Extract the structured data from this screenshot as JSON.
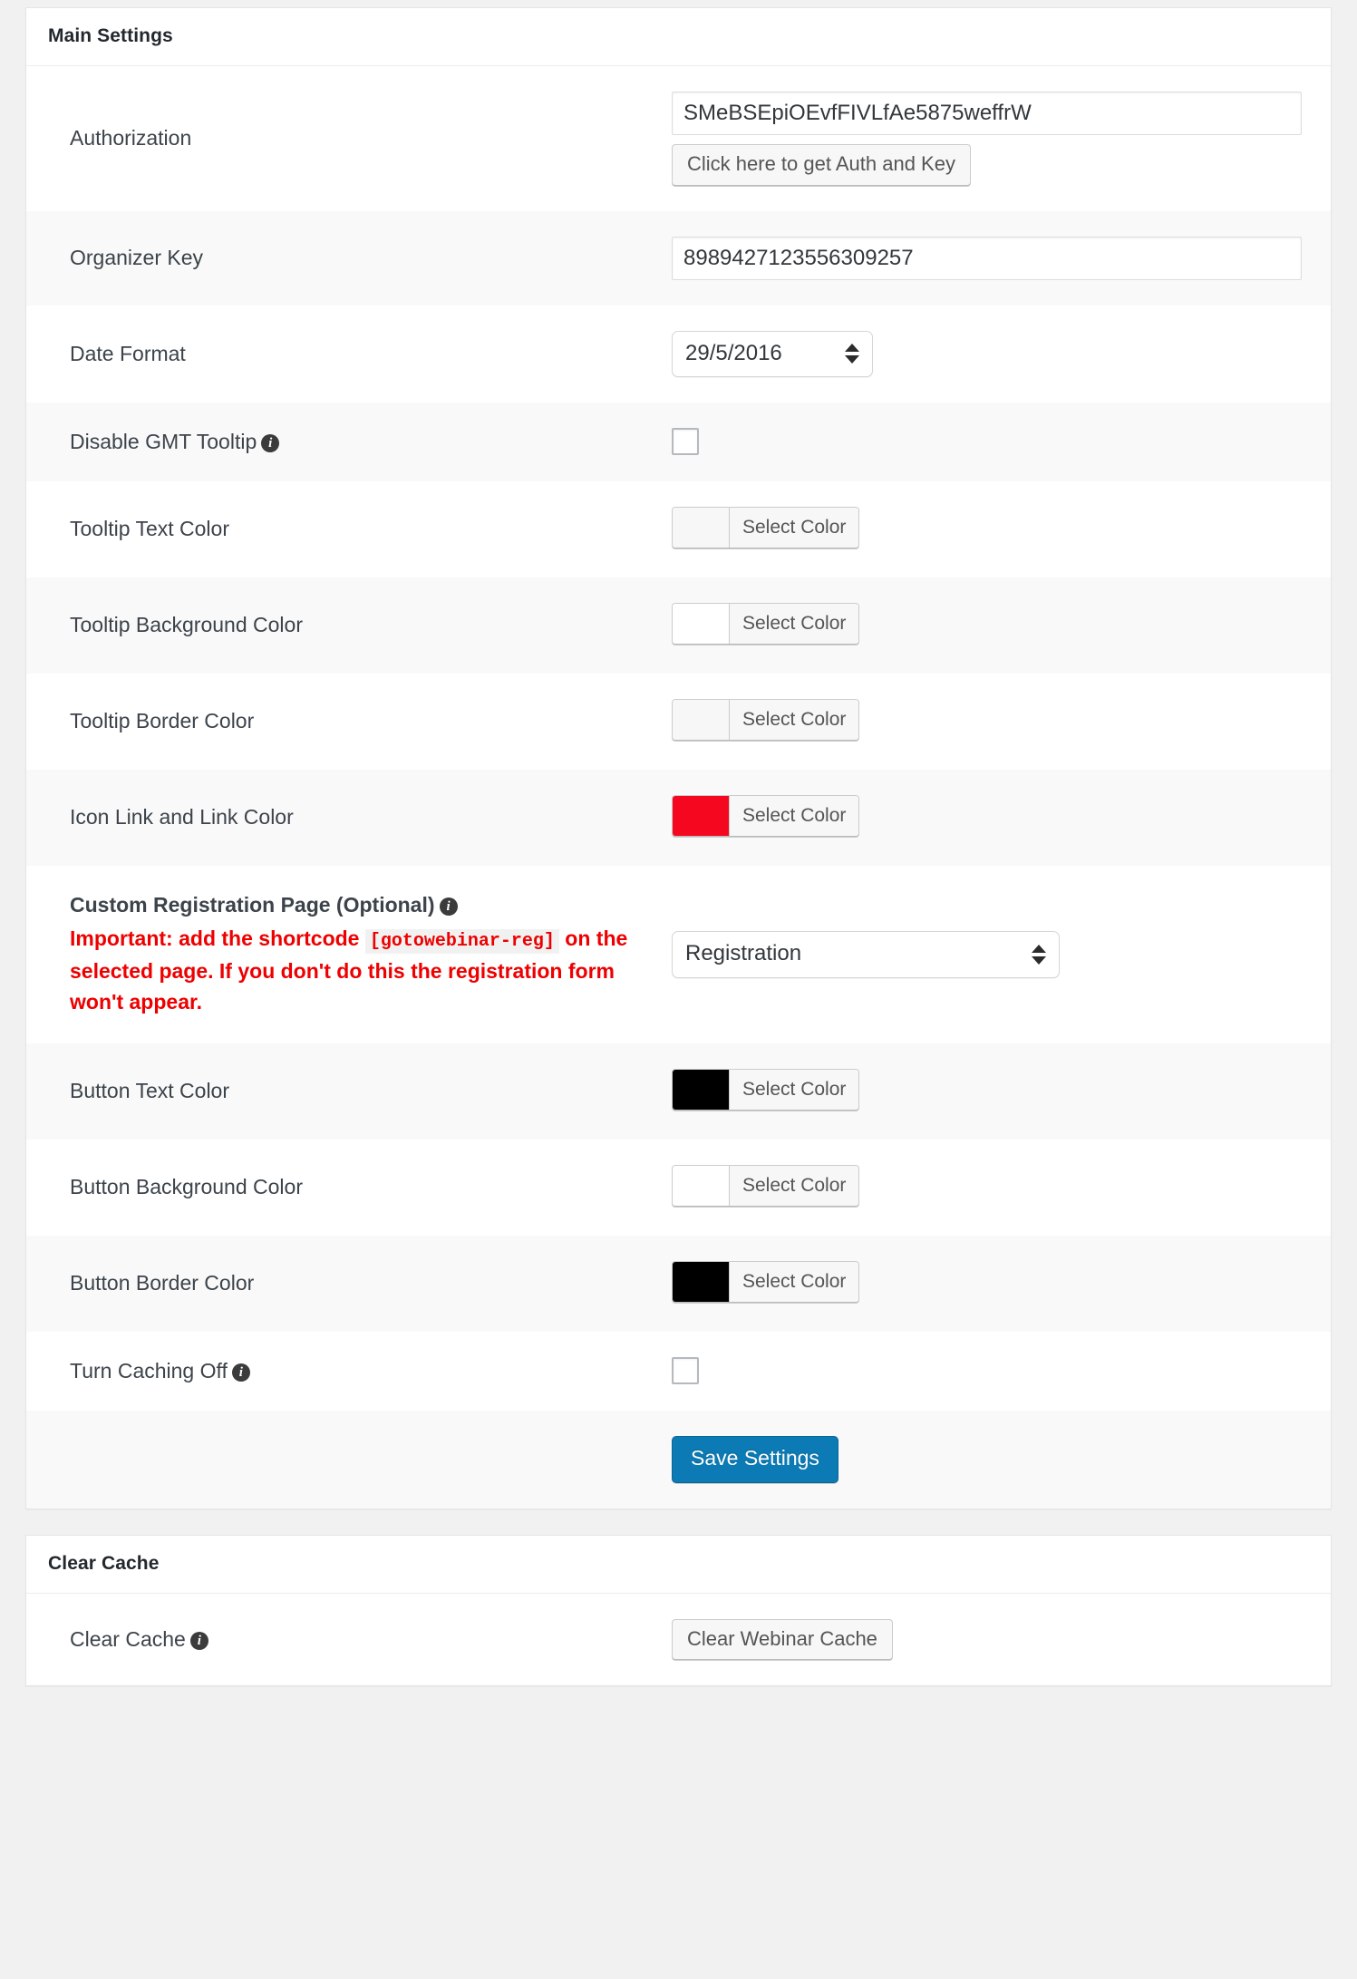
{
  "main_settings": {
    "title": "Main Settings",
    "rows": {
      "authorization": {
        "label": "Authorization",
        "value": "SMeBSEpiOEvfFIVLfAe5875weffrW",
        "button_label": "Click here to get Auth and Key"
      },
      "organizer_key": {
        "label": "Organizer Key",
        "value": "8989427123556309257"
      },
      "date_format": {
        "label": "Date Format",
        "value": "29/5/2016",
        "options": [
          "29/5/2016"
        ]
      },
      "disable_gmt_tooltip": {
        "label": "Disable GMT Tooltip",
        "info_icon": "info-icon",
        "checked": false
      },
      "tooltip_text_color": {
        "label": "Tooltip Text Color",
        "button_label": "Select Color",
        "swatch": "#f7f7f7"
      },
      "tooltip_background_color": {
        "label": "Tooltip Background Color",
        "button_label": "Select Color",
        "swatch": "#ffffff"
      },
      "tooltip_border_color": {
        "label": "Tooltip Border Color",
        "button_label": "Select Color",
        "swatch": "#f7f7f7"
      },
      "icon_link_color": {
        "label": "Icon Link and Link Color",
        "button_label": "Select Color",
        "swatch": "#f5081f"
      },
      "custom_registration_page": {
        "label": "Custom Registration Page (Optional)",
        "info_icon": "info-icon",
        "warning_strong": "Important:",
        "warning_part1": " add the shortcode ",
        "warning_code": "[gotowebinar-reg]",
        "warning_part2": " on the selected page. If you don't do this the registration form won't appear.",
        "value": "Registration",
        "options": [
          "Registration"
        ]
      },
      "button_text_color": {
        "label": "Button Text Color",
        "button_label": "Select Color",
        "swatch": "#000000"
      },
      "button_background_color": {
        "label": "Button Background Color",
        "button_label": "Select Color",
        "swatch": "#ffffff"
      },
      "button_border_color": {
        "label": "Button Border Color",
        "button_label": "Select Color",
        "swatch": "#000000"
      },
      "turn_caching_off": {
        "label": "Turn Caching Off",
        "info_icon": "info-icon",
        "checked": false
      }
    },
    "save_label": "Save Settings"
  },
  "clear_cache": {
    "title": "Clear Cache",
    "row": {
      "label": "Clear Cache",
      "info_icon": "info-icon",
      "button_label": "Clear Webinar Cache"
    }
  },
  "colors": {
    "primary": "#0c7ab5",
    "warning": "#ee0000",
    "accent_red": "#f5081f"
  }
}
